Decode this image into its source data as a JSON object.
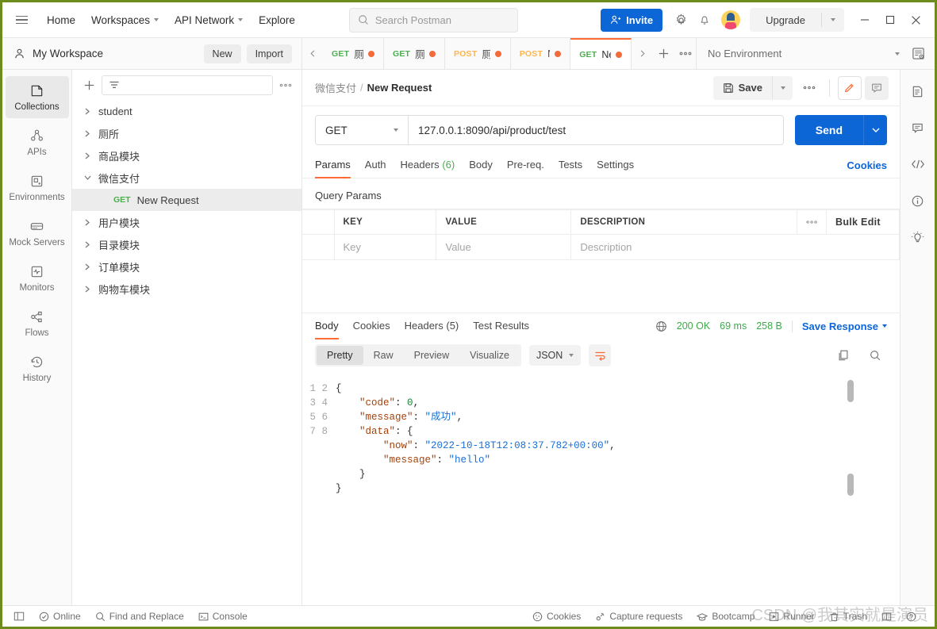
{
  "header": {
    "menu_icon": "hamburger-icon",
    "nav": [
      {
        "label": "Home",
        "caret": false
      },
      {
        "label": "Workspaces",
        "caret": true
      },
      {
        "label": "API Network",
        "caret": true
      },
      {
        "label": "Explore",
        "caret": false
      }
    ],
    "search_placeholder": "Search Postman",
    "invite_label": "Invite",
    "upgrade_label": "Upgrade",
    "settings_icon": "gear-icon",
    "notifications_icon": "bell-icon",
    "avatar_icon": "user-avatar",
    "window": {
      "minimize": "—",
      "maximize": "□",
      "close": "✕"
    }
  },
  "workspace": {
    "name": "My Workspace",
    "new_label": "New",
    "import_label": "Import"
  },
  "tabs": {
    "prev_icon": "chevron-left-icon",
    "next_icon": "chevron-right-icon",
    "add_icon": "plus-icon",
    "more_icon": "ellipsis-icon",
    "items": [
      {
        "method": "GET",
        "label": "厕所",
        "unsaved": true,
        "active": false
      },
      {
        "method": "GET",
        "label": "厕所",
        "unsaved": true,
        "active": false
      },
      {
        "method": "POST",
        "label": "厕所",
        "unsaved": true,
        "active": false
      },
      {
        "method": "POST",
        "label": "Ne",
        "unsaved": true,
        "active": false
      },
      {
        "method": "GET",
        "label": "New",
        "unsaved": true,
        "active": true
      }
    ],
    "environment": "No Environment",
    "env_eye_icon": "environment-quicklook-icon"
  },
  "rail": {
    "items": [
      {
        "label": "Collections",
        "icon": "collections-icon",
        "active": true
      },
      {
        "label": "APIs",
        "icon": "apis-icon",
        "active": false
      },
      {
        "label": "Environments",
        "icon": "environments-icon",
        "active": false
      },
      {
        "label": "Mock Servers",
        "icon": "mock-servers-icon",
        "active": false
      },
      {
        "label": "Monitors",
        "icon": "monitors-icon",
        "active": false
      },
      {
        "label": "Flows",
        "icon": "flows-icon",
        "active": false
      },
      {
        "label": "History",
        "icon": "history-icon",
        "active": false
      }
    ]
  },
  "sidebar": {
    "add_icon": "plus-icon",
    "filter_icon": "filter-icon",
    "filter_placeholder": "",
    "more_icon": "ellipsis-icon",
    "collections": [
      {
        "name": "student",
        "expanded": false
      },
      {
        "name": "厕所",
        "expanded": false
      },
      {
        "name": "商品模块",
        "expanded": false
      },
      {
        "name": "微信支付",
        "expanded": true,
        "requests": [
          {
            "method": "GET",
            "name": "New Request",
            "selected": true
          }
        ]
      },
      {
        "name": "用户模块",
        "expanded": false
      },
      {
        "name": "目录模块",
        "expanded": false
      },
      {
        "name": "订单模块",
        "expanded": false
      },
      {
        "name": "购物车模块",
        "expanded": false
      }
    ]
  },
  "request": {
    "breadcrumb_parent": "微信支付",
    "breadcrumb_sep": "/",
    "breadcrumb_current": "New Request",
    "save_label": "Save",
    "save_icon": "floppy-disk-icon",
    "more_icon": "ellipsis-icon",
    "pencil_icon": "pencil-icon",
    "comment_icon": "comment-icon",
    "method": "GET",
    "url": "127.0.0.1:8090/api/product/test",
    "send_label": "Send",
    "tabs": [
      {
        "label": "Params",
        "count": "",
        "active": true
      },
      {
        "label": "Auth",
        "count": "",
        "active": false
      },
      {
        "label": "Headers",
        "count": "(6)",
        "active": false
      },
      {
        "label": "Body",
        "count": "",
        "active": false
      },
      {
        "label": "Pre-req.",
        "count": "",
        "active": false
      },
      {
        "label": "Tests",
        "count": "",
        "active": false
      },
      {
        "label": "Settings",
        "count": "",
        "active": false
      }
    ],
    "cookies_link": "Cookies",
    "query_params_title": "Query Params",
    "table": {
      "headers": [
        "KEY",
        "VALUE",
        "DESCRIPTION"
      ],
      "more_icon": "ellipsis-icon",
      "bulk_edit_label": "Bulk Edit",
      "rows": [
        {
          "key_placeholder": "Key",
          "value_placeholder": "Value",
          "description_placeholder": "Description"
        }
      ]
    }
  },
  "response": {
    "tabs": [
      {
        "label": "Body",
        "active": true
      },
      {
        "label": "Cookies",
        "active": false
      },
      {
        "label": "Headers (5)",
        "active": false
      },
      {
        "label": "Test Results",
        "active": false
      }
    ],
    "globe_icon": "globe-icon",
    "status": "200 OK",
    "time": "69 ms",
    "size": "258 B",
    "save_response_label": "Save Response",
    "view_modes": [
      {
        "label": "Pretty",
        "active": true
      },
      {
        "label": "Raw",
        "active": false
      },
      {
        "label": "Preview",
        "active": false
      },
      {
        "label": "Visualize",
        "active": false
      }
    ],
    "format": "JSON",
    "wrap_icon": "wrap-lines-icon",
    "copy_icon": "copy-icon",
    "search_icon": "search-icon",
    "line_numbers": [
      "1",
      "2",
      "3",
      "4",
      "5",
      "6",
      "7",
      "8"
    ],
    "body_lines": [
      [
        {
          "t": "p",
          "v": "{"
        }
      ],
      [
        {
          "t": "p",
          "v": "    "
        },
        {
          "t": "k",
          "v": "\"code\""
        },
        {
          "t": "p",
          "v": ": "
        },
        {
          "t": "n",
          "v": "0"
        },
        {
          "t": "p",
          "v": ","
        }
      ],
      [
        {
          "t": "p",
          "v": "    "
        },
        {
          "t": "k",
          "v": "\"message\""
        },
        {
          "t": "p",
          "v": ": "
        },
        {
          "t": "s",
          "v": "\"成功\""
        },
        {
          "t": "p",
          "v": ","
        }
      ],
      [
        {
          "t": "p",
          "v": "    "
        },
        {
          "t": "k",
          "v": "\"data\""
        },
        {
          "t": "p",
          "v": ": {"
        }
      ],
      [
        {
          "t": "p",
          "v": "        "
        },
        {
          "t": "k",
          "v": "\"now\""
        },
        {
          "t": "p",
          "v": ": "
        },
        {
          "t": "s",
          "v": "\"2022-10-18T12:08:37.782+00:00\""
        },
        {
          "t": "p",
          "v": ","
        }
      ],
      [
        {
          "t": "p",
          "v": "        "
        },
        {
          "t": "k",
          "v": "\"message\""
        },
        {
          "t": "p",
          "v": ": "
        },
        {
          "t": "s",
          "v": "\"hello\""
        }
      ],
      [
        {
          "t": "p",
          "v": "    }"
        }
      ],
      [
        {
          "t": "p",
          "v": "}"
        }
      ]
    ]
  },
  "right_rail": {
    "items": [
      {
        "icon": "documentation-icon"
      },
      {
        "icon": "comments-icon"
      },
      {
        "icon": "code-snippet-icon"
      },
      {
        "icon": "info-icon"
      },
      {
        "icon": "lightbulb-icon"
      }
    ]
  },
  "footer": {
    "sidebar_toggle_icon": "sidebar-toggle-icon",
    "left": [
      {
        "label": "Online",
        "icon": "check-circle-icon"
      },
      {
        "label": "Find and Replace",
        "icon": "search-icon"
      },
      {
        "label": "Console",
        "icon": "console-icon"
      }
    ],
    "right": [
      {
        "label": "Cookies",
        "icon": "cookie-icon"
      },
      {
        "label": "Capture requests",
        "icon": "satellite-icon"
      },
      {
        "label": "Bootcamp",
        "icon": "graduation-cap-icon"
      },
      {
        "label": "Runner",
        "icon": "runner-icon"
      },
      {
        "label": "Trash",
        "icon": "trash-icon"
      },
      {
        "label": "",
        "icon": "layout-icon"
      },
      {
        "label": "",
        "icon": "help-icon"
      }
    ],
    "watermark": "CSDN @我其实就是演员"
  },
  "colors": {
    "accent_orange": "#ff6c37",
    "blue": "#0c66d6",
    "green": "#3bab4a",
    "post_orange": "#ffb44d",
    "unsaved_dot": "#f26b3a",
    "window_border": "#6e8b1e"
  }
}
